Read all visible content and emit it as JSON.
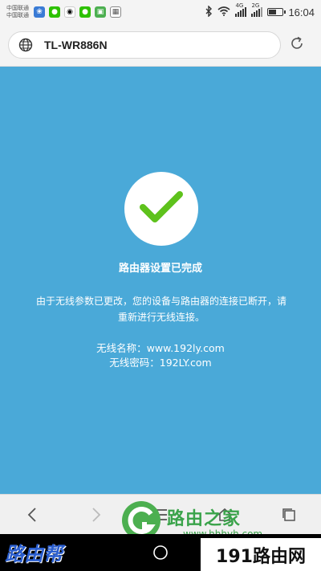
{
  "status_bar": {
    "carrier_1": "中国联通",
    "carrier_2": "中国联通",
    "signal_1_label": "4G",
    "signal_2_label": "2G",
    "time": "16:04",
    "battery_level": 0.6,
    "notification_icons": [
      "baidu-icon",
      "wechat-icon",
      "qq-icon",
      "wechat-icon",
      "image-icon",
      "gallery-icon"
    ]
  },
  "address_bar": {
    "url": "TL-WR886N"
  },
  "main": {
    "title": "路由器设置已完成",
    "description": "由于无线参数已更改，您的设备与路由器的连接已断开，请重新进行无线连接。",
    "ssid_label": "无线名称：",
    "ssid_value": "www.192ly.com",
    "password_label": "无线密码：",
    "password_value": "192LY.com"
  },
  "watermarks": {
    "left": "路由帮",
    "center_title": "路由之家",
    "center_url": "www.hhhyh.com",
    "right": "191路由网"
  },
  "colors": {
    "background": "#4aa9d8",
    "check": "#5ec21c",
    "text": "#ffffff"
  }
}
